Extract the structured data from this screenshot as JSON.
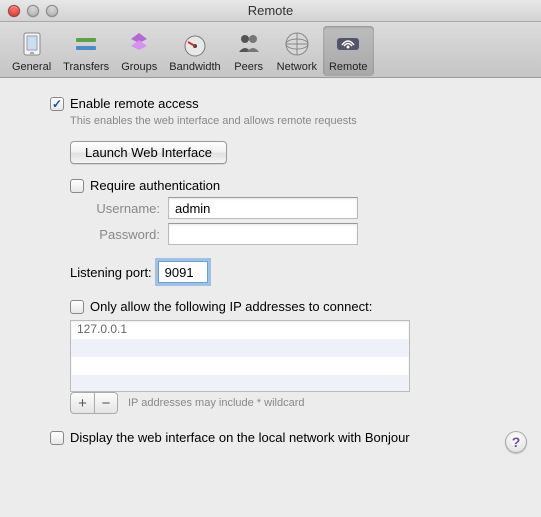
{
  "window": {
    "title": "Remote"
  },
  "toolbar": {
    "items": [
      {
        "label": "General"
      },
      {
        "label": "Transfers"
      },
      {
        "label": "Groups"
      },
      {
        "label": "Bandwidth"
      },
      {
        "label": "Peers"
      },
      {
        "label": "Network"
      },
      {
        "label": "Remote"
      }
    ]
  },
  "remote": {
    "enable_label": "Enable remote access",
    "enable_help": "This enables the web interface and allows remote requests",
    "launch_btn": "Launch Web Interface",
    "require_auth_label": "Require authentication",
    "username_label": "Username:",
    "username_value": "admin",
    "password_label": "Password:",
    "password_value": "",
    "port_label": "Listening port:",
    "port_value": "9091",
    "only_allow_label": "Only allow the following IP addresses to connect:",
    "ip_list": [
      "127.0.0.1"
    ],
    "ip_hint": "IP addresses may include * wildcard",
    "bonjour_label": "Display the web interface on the local network with Bonjour"
  },
  "help_glyph": "?"
}
